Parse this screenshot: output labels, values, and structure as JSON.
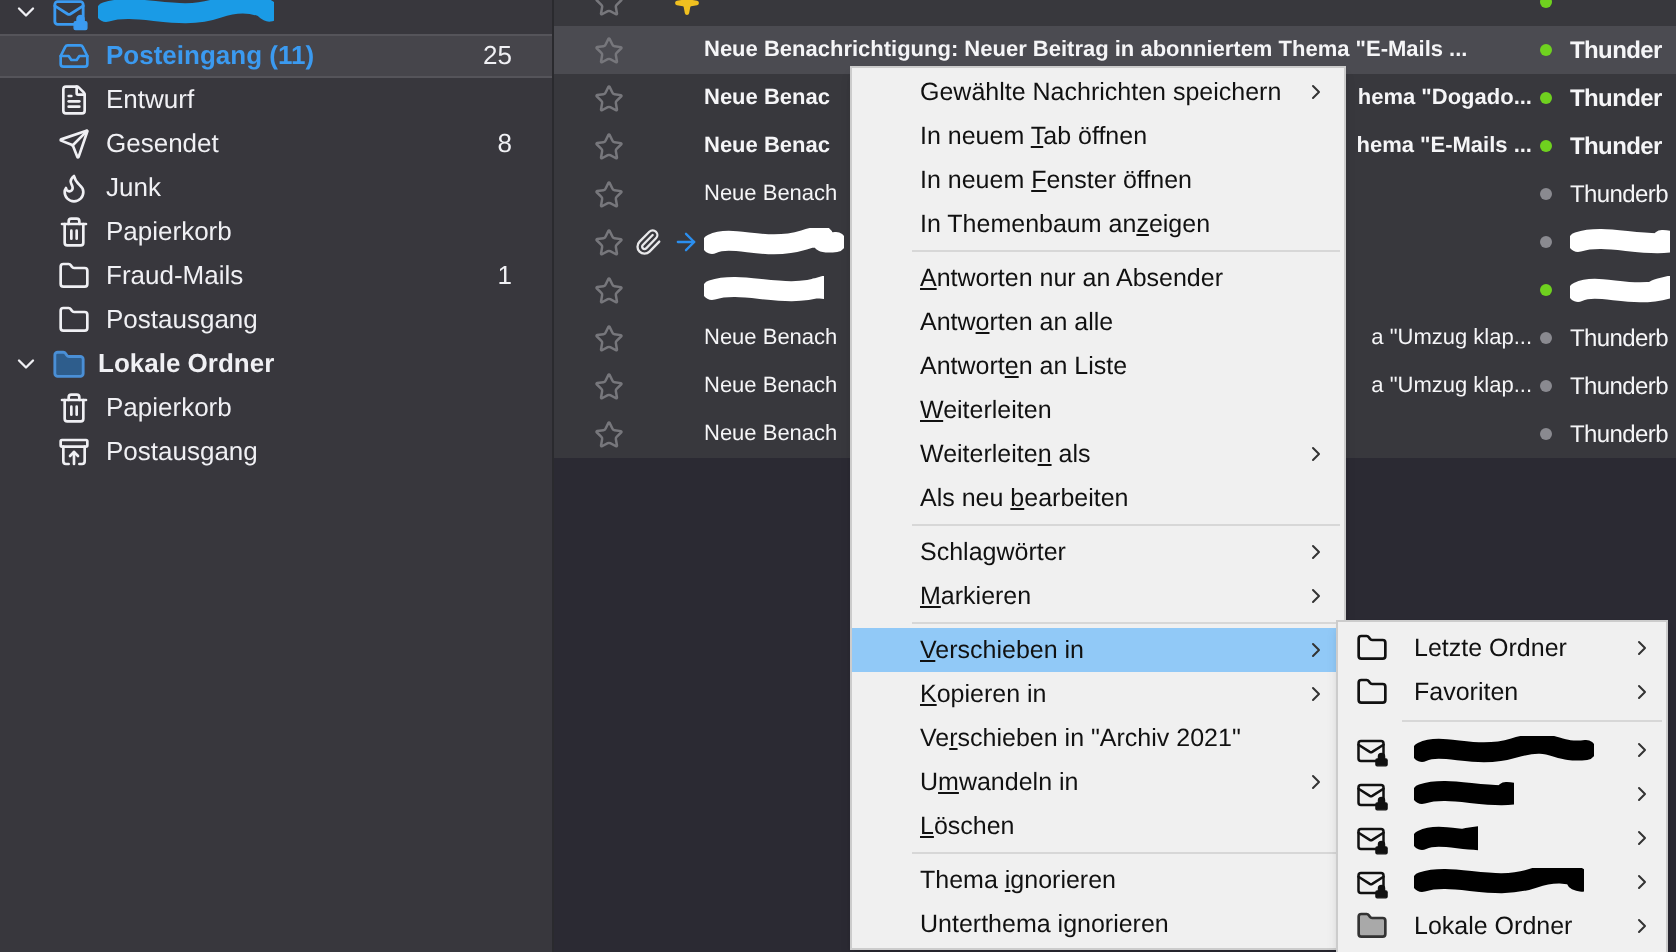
{
  "sidebar": {
    "folders": [
      {
        "kind": "account",
        "redacted": true,
        "expanded": true,
        "children": [
          {
            "kind": "inbox",
            "label": "Posteingang (11)",
            "count": "25",
            "selected": true
          },
          {
            "kind": "draft",
            "label": "Entwurf",
            "selected": false
          },
          {
            "kind": "sent",
            "label": "Gesendet",
            "count": "8",
            "selected": false
          },
          {
            "kind": "junk",
            "label": "Junk",
            "selected": false
          },
          {
            "kind": "trash",
            "label": "Papierkorb",
            "selected": false
          },
          {
            "kind": "folder",
            "label": "Fraud-Mails",
            "count": "1",
            "selected": false
          },
          {
            "kind": "folder",
            "label": "Postausgang",
            "selected": false
          }
        ]
      },
      {
        "kind": "local",
        "label": "Lokale Ordner",
        "expanded": true,
        "children": [
          {
            "kind": "trash",
            "label": "Papierkorb",
            "selected": false
          },
          {
            "kind": "outbox",
            "label": "Postausgang",
            "selected": false
          }
        ]
      }
    ]
  },
  "messages": [
    {
      "selected": false,
      "new": true,
      "unread": true,
      "attachment": false,
      "replied": false
    },
    {
      "selected": true,
      "new": false,
      "unread": true,
      "attachment": false,
      "replied": false,
      "subject": "Neue Benachrichtigung: Neuer Beitrag in abonniertem Thema \"E-Mails ...",
      "correspondent": "Thunder"
    },
    {
      "selected": false,
      "new": false,
      "unread": true,
      "attachment": false,
      "replied": false,
      "subject": "Neue Benac",
      "subject_tail": "hema \"Dogado...",
      "correspondent": "Thunder"
    },
    {
      "selected": false,
      "new": false,
      "unread": true,
      "attachment": false,
      "replied": false,
      "subject": "Neue Benac",
      "subject_tail": "hema \"E-Mails ...",
      "correspondent": "Thunder"
    },
    {
      "selected": false,
      "new": false,
      "unread": false,
      "attachment": false,
      "replied": false,
      "subject": "Neue Benach",
      "correspondent": "Thunderb"
    },
    {
      "selected": false,
      "new": false,
      "unread": false,
      "attachment": true,
      "replied": true,
      "redacted": true
    },
    {
      "selected": false,
      "new": false,
      "unread": true,
      "attachment": false,
      "replied": false,
      "redacted": true
    },
    {
      "selected": false,
      "new": false,
      "unread": false,
      "attachment": false,
      "replied": false,
      "subject": "Neue Benach",
      "subject_tail": "a \"Umzug klap...",
      "correspondent": "Thunderb"
    },
    {
      "selected": false,
      "new": false,
      "unread": false,
      "attachment": false,
      "replied": false,
      "subject": "Neue Benach",
      "subject_tail": "a \"Umzug klap...",
      "correspondent": "Thunderb"
    },
    {
      "selected": false,
      "new": false,
      "unread": false,
      "attachment": false,
      "replied": false,
      "subject": "Neue Benach",
      "correspondent": "Thunderb"
    }
  ],
  "context_menu": {
    "items": [
      {
        "kind": "item",
        "before": "Gewählte Nachrichten speichern",
        "submenu": true,
        "selected": false
      },
      {
        "kind": "item",
        "before": "In neuem ",
        "key": "T",
        "after": "ab öffnen",
        "submenu": false,
        "selected": false
      },
      {
        "kind": "item",
        "before": "In neuem ",
        "key": "F",
        "after": "enster öffnen",
        "submenu": false,
        "selected": false
      },
      {
        "kind": "item",
        "before": "In Themenbaum an",
        "key": "z",
        "after": "eigen",
        "submenu": false,
        "selected": false
      },
      {
        "kind": "separator"
      },
      {
        "kind": "item",
        "key": "A",
        "after": "ntworten nur an Absender",
        "submenu": false,
        "selected": false
      },
      {
        "kind": "item",
        "before": "Antw",
        "key": "o",
        "after": "rten an alle",
        "submenu": false,
        "selected": false
      },
      {
        "kind": "item",
        "before": "Antwort",
        "key": "e",
        "after": "n an Liste",
        "submenu": false,
        "selected": false
      },
      {
        "kind": "item",
        "key": "W",
        "after": "eiterleiten",
        "submenu": false,
        "selected": false
      },
      {
        "kind": "item",
        "before": "Weiterleite",
        "key": "n",
        "after": " als",
        "submenu": true,
        "selected": false
      },
      {
        "kind": "item",
        "before": "Als neu ",
        "key": "b",
        "after": "earbeiten",
        "submenu": false,
        "selected": false
      },
      {
        "kind": "separator"
      },
      {
        "kind": "item",
        "before": "Schla",
        "key": "g",
        "after": "wörter",
        "submenu": true,
        "selected": false
      },
      {
        "kind": "item",
        "key": "M",
        "after": "arkieren",
        "submenu": true,
        "selected": false
      },
      {
        "kind": "separator"
      },
      {
        "kind": "item",
        "key": "V",
        "after": "erschieben in",
        "submenu": true,
        "selected": true
      },
      {
        "kind": "item",
        "key": "K",
        "after": "opieren in",
        "submenu": true,
        "selected": false
      },
      {
        "kind": "item",
        "before": "Ve",
        "key": "r",
        "after": "schieben in \"Archiv 2021\"",
        "submenu": false,
        "selected": false
      },
      {
        "kind": "item",
        "before": "U",
        "key": "m",
        "after": "wandeln in",
        "submenu": true,
        "selected": false
      },
      {
        "kind": "item",
        "key": "L",
        "after": "öschen",
        "submenu": false,
        "selected": false
      },
      {
        "kind": "separator"
      },
      {
        "kind": "item",
        "before": "Thema ",
        "key": "i",
        "after": "gnorieren",
        "submenu": false,
        "selected": false
      },
      {
        "kind": "item",
        "before": "Unterthema i",
        "key": "g",
        "after": "norieren",
        "submenu": false,
        "selected": false
      }
    ]
  },
  "submenu": {
    "items": [
      {
        "kind": "folder",
        "label": "Letzte Ordner"
      },
      {
        "kind": "folder",
        "label": "Favoriten"
      },
      {
        "kind": "separator"
      },
      {
        "kind": "account",
        "redacted": true
      },
      {
        "kind": "account",
        "redacted": true
      },
      {
        "kind": "account",
        "redacted": true
      },
      {
        "kind": "account",
        "redacted": true
      },
      {
        "kind": "local",
        "label": "Lokale Ordner"
      }
    ]
  }
}
